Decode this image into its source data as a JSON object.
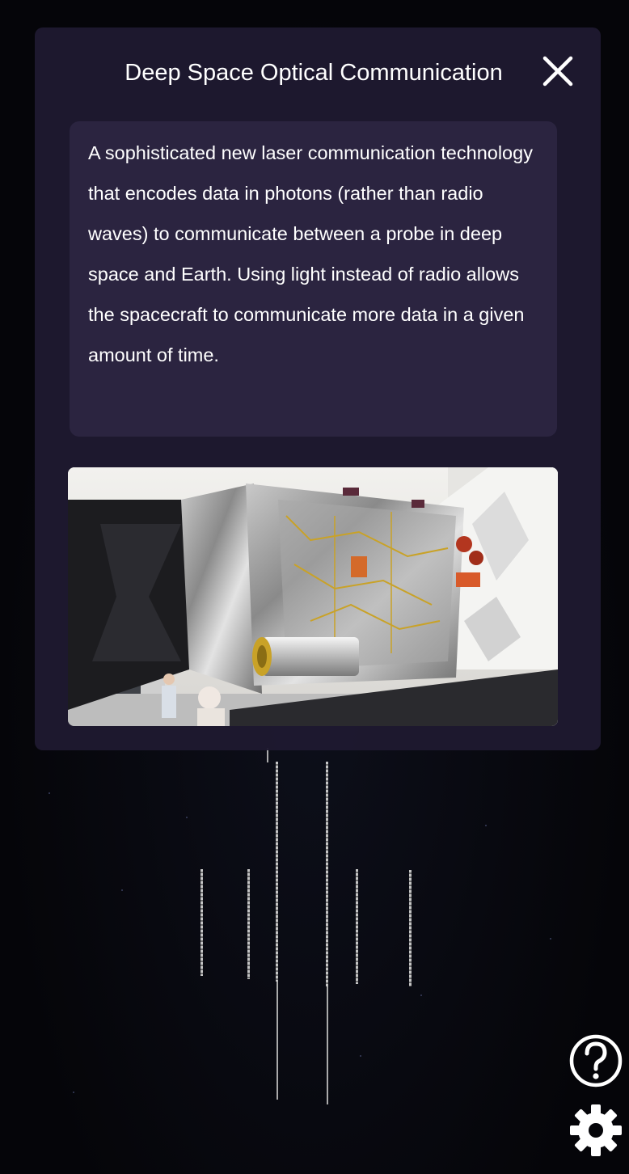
{
  "dialog": {
    "title": "Deep Space Optical Communication",
    "description": "A sophisticated new laser communication technology that encodes data in photons (rather than radio waves) to communicate between a probe in deep space and Earth. Using light instead of radio allows the spacecraft to communicate more data in a given amount of time.",
    "close_icon": "close-icon",
    "image_icon": "spacecraft-photo"
  },
  "controls": {
    "help_icon": "help-icon",
    "settings_icon": "gear-icon"
  },
  "colors": {
    "panel_bg": "#1e1930",
    "text_box_bg": "#2b2440",
    "text": "#ffffff",
    "background": "#050509"
  }
}
